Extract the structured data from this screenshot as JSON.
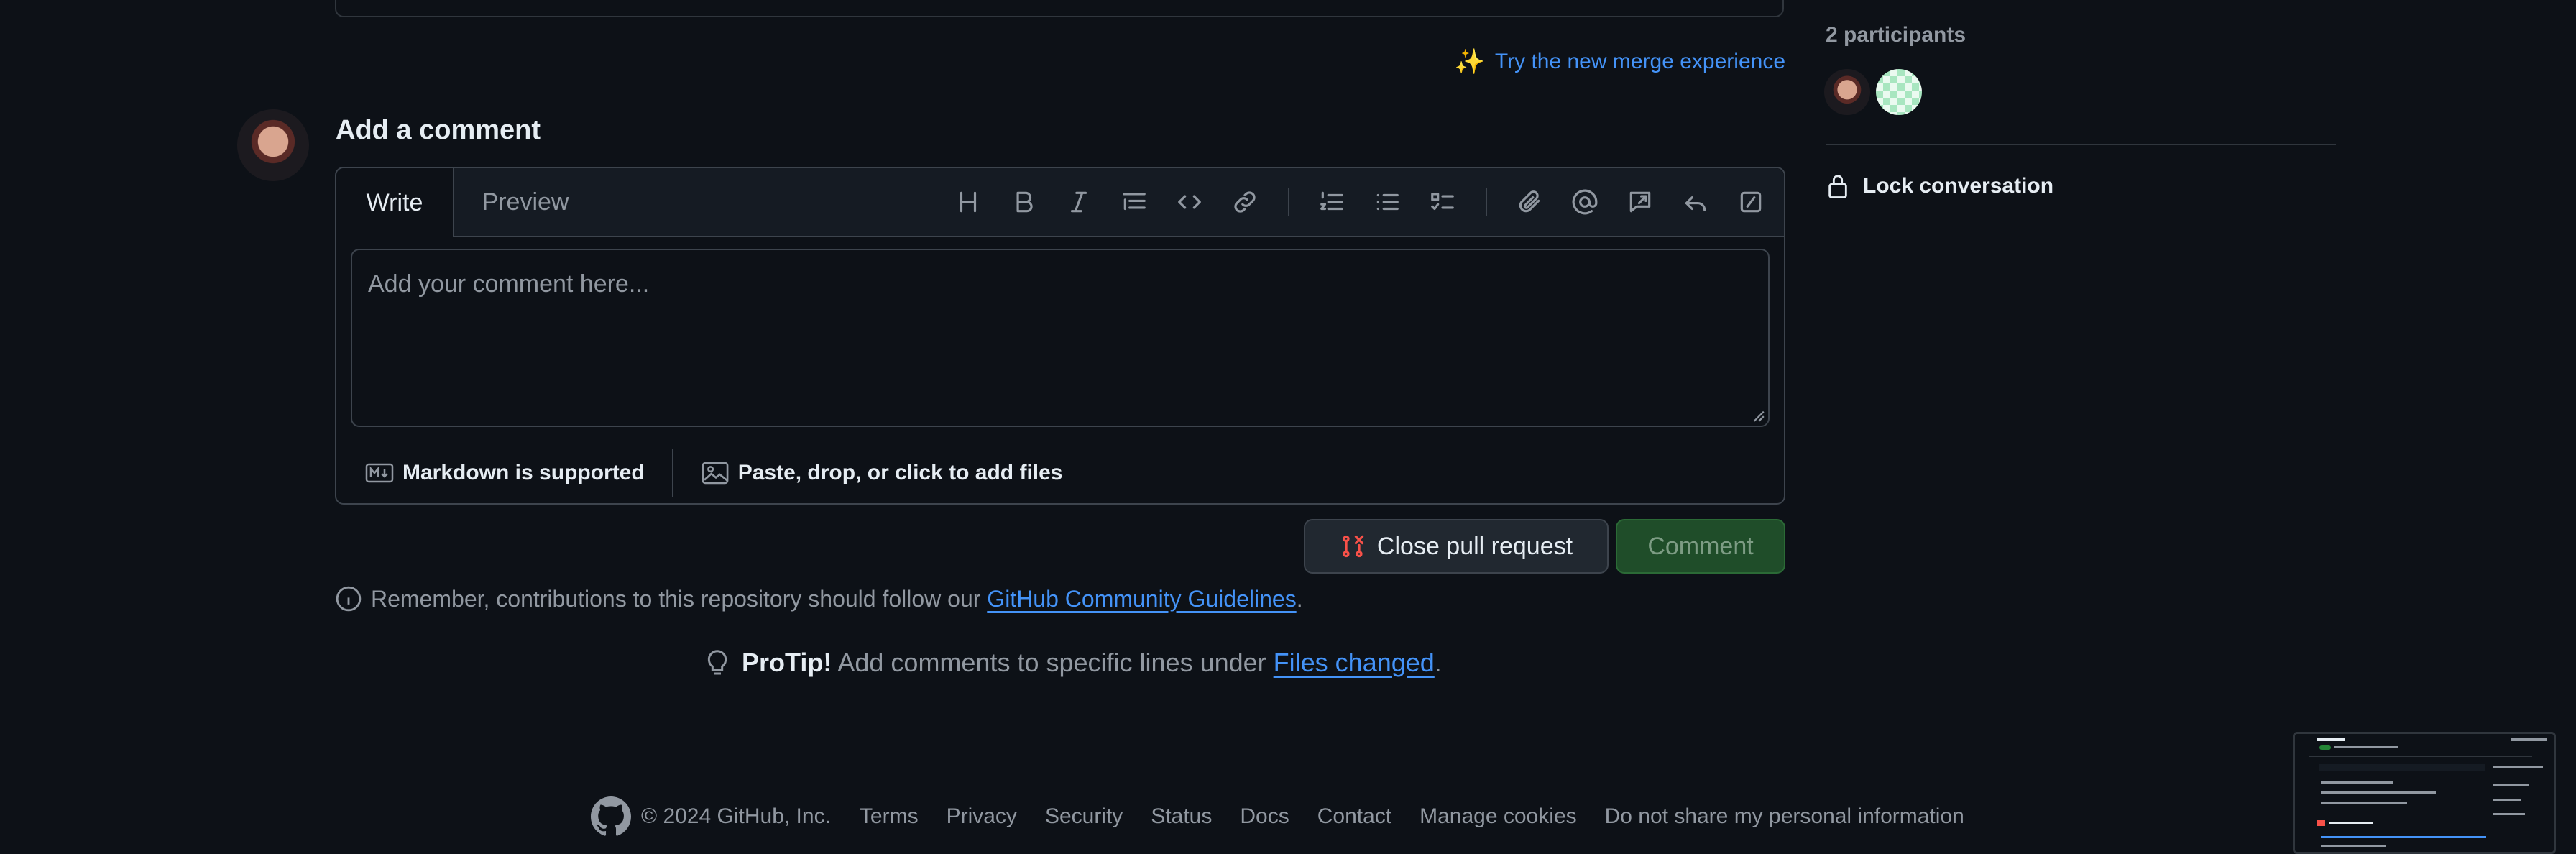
{
  "merge_experience": {
    "label": "Try the new merge experience"
  },
  "comment_box": {
    "heading": "Add a comment",
    "tabs": [
      "Write",
      "Preview"
    ],
    "placeholder": "Add your comment here...",
    "markdown_label": "Markdown is supported",
    "attach_label": "Paste, drop, or click to add files",
    "toolbar_icons": [
      "heading-icon",
      "bold-icon",
      "italic-icon",
      "quote-icon",
      "code-icon",
      "link-icon",
      "ordered-list-icon",
      "unordered-list-icon",
      "task-list-icon",
      "attach-icon",
      "mention-icon",
      "reference-icon",
      "reply-icon",
      "slash-commands-icon"
    ]
  },
  "actions": {
    "close_pr": "Close pull request",
    "comment": "Comment"
  },
  "notice": {
    "remember_prefix": "Remember, contributions to this repository should follow our ",
    "guidelines_link": "GitHub Community Guidelines",
    "remember_suffix": "."
  },
  "protip": {
    "label": "ProTip!",
    "text": " Add comments to specific lines under ",
    "link": "Files changed",
    "suffix": "."
  },
  "sidebar": {
    "participants_title": "2 participants",
    "lock_label": "Lock conversation"
  },
  "footer": {
    "copyright": "© 2024 GitHub, Inc.",
    "links": [
      "Terms",
      "Privacy",
      "Security",
      "Status",
      "Docs",
      "Contact",
      "Manage cookies",
      "Do not share my personal information"
    ]
  },
  "colors": {
    "background": "#0d1117",
    "accent_link": "#4493f8",
    "comment_button": "#1f4d29",
    "close_icon": "#f85149"
  }
}
